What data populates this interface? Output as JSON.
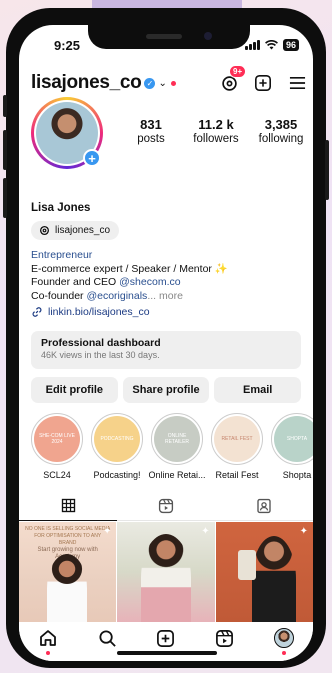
{
  "status_bar": {
    "time": "9:25",
    "battery": "96"
  },
  "header": {
    "username": "lisajones_co",
    "threads_badge": "9+"
  },
  "profile": {
    "stats": [
      {
        "num": "831",
        "label": "posts"
      },
      {
        "num": "11.2 k",
        "label": "followers"
      },
      {
        "num": "3,385",
        "label": "following"
      }
    ],
    "display_name": "Lisa Jones",
    "threads_handle": "lisajones_co",
    "category": "Entrepreneur",
    "bio_line1": "E-commerce expert / Speaker / Mentor ✨",
    "bio_line2_prefix": "Founder and CEO ",
    "bio_line2_mention": "@shecom.co",
    "bio_line3_prefix": "Co-founder ",
    "bio_line3_mention": "@ecoriginals",
    "bio_more": "... more",
    "link": "linkin.bio/lisajones_co"
  },
  "dashboard": {
    "title": "Professional dashboard",
    "subtitle": "46K views in the last 30 days."
  },
  "buttons": {
    "edit": "Edit profile",
    "share": "Share profile",
    "email": "Email"
  },
  "highlights": [
    {
      "label": "SCL24",
      "cover_text": "SHE-COM LIVE 2024",
      "color": "#f0a58f"
    },
    {
      "label": "Podcasting!",
      "cover_text": "PODCASTING",
      "color": "#f6d28a"
    },
    {
      "label": "Online Retai...",
      "cover_text": "ONLINE RETAILER",
      "color": "#c7ccc4"
    },
    {
      "label": "Retail Fest",
      "cover_text": "RETAIL FEST",
      "color": "#f3e2d2"
    },
    {
      "label": "Shopta",
      "cover_text": "SHOPTA",
      "color": "#b9d3c9"
    }
  ],
  "grid": {
    "post1_text": "NO ONE IS SELLING SOCIAL MEDIA FOR OPTIMISATION TO ANY BRAND",
    "post1_sub": "Start growing now with Academy"
  },
  "colors": {
    "accent": "#3897f0",
    "notification": "#ff2d55",
    "link": "#1b3a82"
  }
}
